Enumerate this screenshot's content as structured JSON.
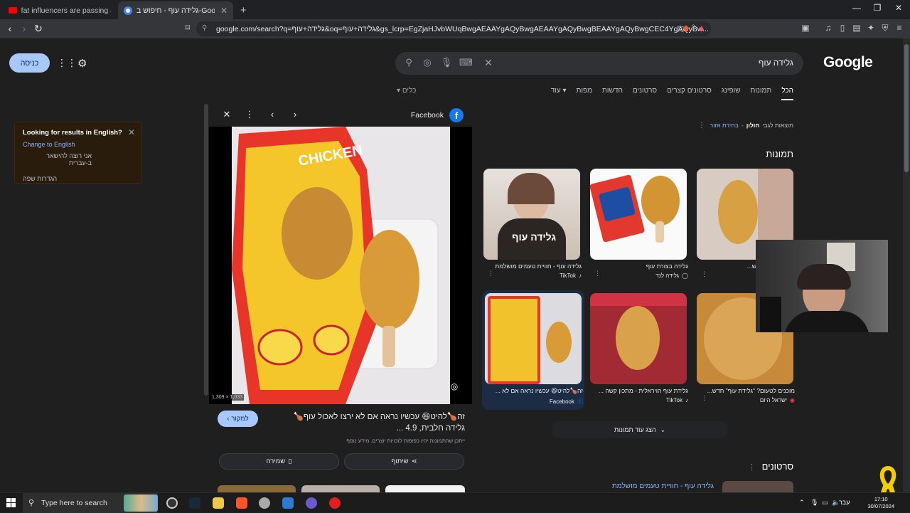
{
  "browser": {
    "tabs": [
      {
        "title": "fat influencers are passing away :( - Y",
        "active": false
      },
      {
        "title": "גלידה עוף - חיפוש ב-Google",
        "active": true
      }
    ],
    "new_tab": "+",
    "url": "google.com/search?q=גלידה+עוף&oq=גלידה+עוף&gs_lcrp=EgZjaHJvbWUqBwgAEAAYgAQyBwgAEAAYgAQyBwgBEAAYgAQyBwgCEC4YgAQyBw..."
  },
  "google": {
    "logo": "Google",
    "query": "גלידה עוף",
    "sign_in": "כניסה",
    "nav": [
      "הכל",
      "תמונות",
      "שופינג",
      "סרטונים קצרים",
      "סרטונים",
      "חדשות",
      "מפות",
      "עוד"
    ],
    "nav_active": "הכל",
    "nav_more_suffix": "▾",
    "tools": "כלים",
    "near": {
      "prefix": "תוצאות לגבי",
      "place": "חולון",
      "change": "בחירת אזור"
    },
    "images_heading": "תמונות",
    "videos_heading": "סרטונים",
    "show_more": "הצג עוד תמונות",
    "image_results": [
      {
        "caption": "גלידה עוף - חוויית טעמים מושלמת",
        "source": "TikTok"
      },
      {
        "caption": "גלידה בצורת עוף",
        "source": "גלידה לנד"
      },
      {
        "caption": "\"גלידת עוף\" חדש...",
        "source": ""
      },
      {
        "caption": "זה🍗להיט😆 עכשיו נראה אם לא ...",
        "source": "Facebook"
      },
      {
        "caption": "גלידת עוף הויראלית - מתכון קשה ...",
        "source": "TikTok"
      },
      {
        "caption": "מוכנים לטעום? \"גלידת עוף\" חדש...",
        "source": "ישראל היום"
      }
    ],
    "video_result": "גלידה עוף - חוויית טעמים מושלמת"
  },
  "lang_popup": {
    "title": "Looking for results in English?",
    "change": "Change to English",
    "keep": "אני רוצה להישאר ב-עברית",
    "settings": "הגדרות שפה"
  },
  "preview": {
    "source": "Facebook",
    "dimensions": "1,309 × 1,033",
    "title": "זה🍗להיט😆 עכשיו נראה אם לא ירצו לאכול עוף🍗 גלידה חלבית, 4.9 ...",
    "visit": "למקור",
    "note": "ייתכן שהתמונות יהיו כפופות לזכויות יוצרים. מידע נוסף",
    "share": "שיתוף",
    "save": "שמירה"
  },
  "taskbar": {
    "search_placeholder": "Type here to search",
    "lang": "עבר",
    "time": "17:10",
    "date": "30/07/2024"
  },
  "colors": {
    "accent": "#a8c7fa",
    "link": "#8ab4f8",
    "bg": "#1f1f1f"
  }
}
